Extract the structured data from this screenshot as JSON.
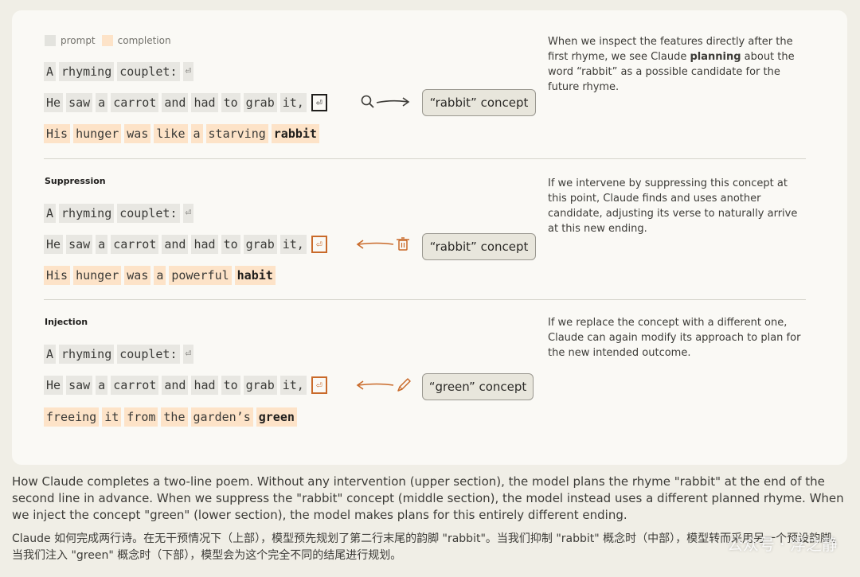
{
  "legend": {
    "prompt": "prompt",
    "completion": "completion"
  },
  "section1": {
    "line1": [
      "A",
      "rhyming",
      "couplet:"
    ],
    "line2": [
      "He",
      "saw",
      "a",
      "carrot",
      "and",
      "had",
      "to",
      "grab",
      "it,"
    ],
    "line3": [
      "His",
      "hunger",
      "was",
      "like",
      "a",
      "starving"
    ],
    "line3_bold": "rabbit",
    "concept": "“rabbit” concept",
    "desc_pre": "When we inspect the features directly after the first rhyme, we see Claude ",
    "desc_bold": "planning",
    "desc_post": " about the word “rabbit” as a possible candidate for the future rhyme."
  },
  "section2": {
    "title": "Suppression",
    "line1": [
      "A",
      "rhyming",
      "couplet:"
    ],
    "line2": [
      "He",
      "saw",
      "a",
      "carrot",
      "and",
      "had",
      "to",
      "grab",
      "it,"
    ],
    "line3": [
      "His",
      "hunger",
      "was",
      "a",
      "powerful"
    ],
    "line3_bold": "habit",
    "concept": "“rabbit” concept",
    "desc": "If we intervene by suppressing this concept at this point, Claude finds and uses another candidate, adjusting its verse to naturally arrive at this new ending."
  },
  "section3": {
    "title": "Injection",
    "line1": [
      "A",
      "rhyming",
      "couplet:"
    ],
    "line2": [
      "He",
      "saw",
      "a",
      "carrot",
      "and",
      "had",
      "to",
      "grab",
      "it,"
    ],
    "line3": [
      "freeing",
      "it",
      "from",
      "the",
      "garden’s"
    ],
    "line3_bold": "green",
    "concept": "“green” concept",
    "desc": "If we replace the concept with a different one, Claude can again modify its approach to plan for the new intended outcome."
  },
  "return_glyph": "⏎",
  "caption_en": "How Claude completes a two-line poem. Without any intervention (upper section), the model plans the rhyme \"rabbit\" at the end of the second line in advance. When we suppress the \"rabbit\" concept (middle section), the model instead uses a different planned rhyme. When we inject the concept \"green\" (lower section), the model makes plans for this entirely different ending.",
  "caption_zh": "Claude 如何完成两行诗。在无干预情况下（上部），模型预先规划了第二行末尾的韵脚 \"rabbit\"。当我们抑制 \"rabbit\" 概念时（中部），模型转而采用另一个预设韵脚。当我们注入 \"green\" 概念时（下部），模型会为这个完全不同的结尾进行规划。",
  "watermark": "公众号 · 浮之静",
  "icons": [
    "magnifier-icon",
    "trash-icon",
    "pencil-icon",
    "arrow-icon",
    "return-icon"
  ],
  "colors": {
    "prompt_bg": "#e8e7e2",
    "completion_bg": "#fde3c8",
    "accent": "#c96a2a"
  }
}
